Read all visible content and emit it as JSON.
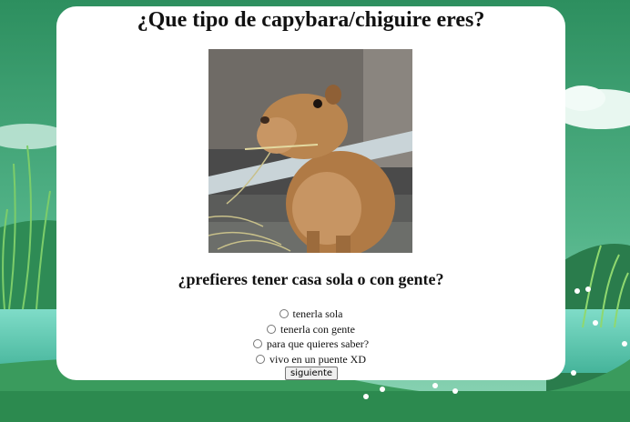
{
  "quiz": {
    "title": "¿Que tipo de capybara/chiguire eres?",
    "question": "¿prefieres tener casa sola o con gente?",
    "image_icon": "capybara-photo",
    "options": [
      "tenerla sola",
      "tenerla con gente",
      "para que quieres saber?",
      "vivo en un puente XD"
    ],
    "submit_label": "siguiente"
  },
  "colors": {
    "sky_top": "#3d9a6e",
    "card": "#ffffff",
    "water": "#6fd0c0",
    "grass": "#2a8a4e"
  }
}
